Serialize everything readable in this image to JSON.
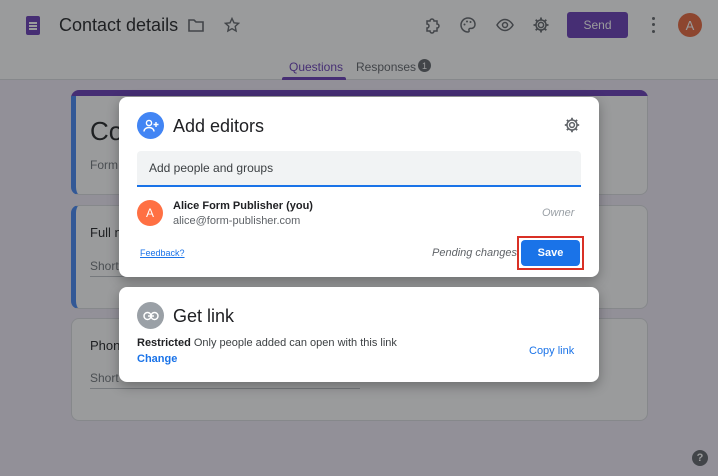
{
  "header": {
    "doc_title": "Contact details",
    "send_label": "Send",
    "account_initial": "A",
    "icons": [
      "doc-icon",
      "folder-icon",
      "star-icon",
      "addon-icon",
      "palette-icon",
      "preview-eye-icon",
      "settings-gear-icon",
      "more-vert-icon"
    ]
  },
  "tabs": [
    {
      "label": "Questions",
      "active": true
    },
    {
      "label": "Responses",
      "badge": "1"
    }
  ],
  "background_form": {
    "title_fragment": "Co",
    "description_fragment": "Form d",
    "question_1_fragment": "Full n",
    "question_1_hint": "Short",
    "question_2_fragment": "Phone",
    "question_2_hint": "Short"
  },
  "add_editors": {
    "heading": "Add editors",
    "input_placeholder": "Add people and groups",
    "people": [
      {
        "initial": "A",
        "name": "Alice Form Publisher (you)",
        "email": "alice@form-publisher.com",
        "role": "Owner"
      }
    ],
    "feedback_label": "Feedback?",
    "pending_label": "Pending changes",
    "save_label": "Save"
  },
  "get_link": {
    "heading": "Get link",
    "restriction_label": "Restricted",
    "restriction_text": "Only people added can open with this link",
    "change_label": "Change",
    "copy_label": "Copy link"
  },
  "help_glyph": "?",
  "colors": {
    "form_purple": "#673ab7",
    "google_blue": "#1a73e8",
    "highlight_red": "#d93025",
    "avatar_orange": "#ff7043"
  }
}
